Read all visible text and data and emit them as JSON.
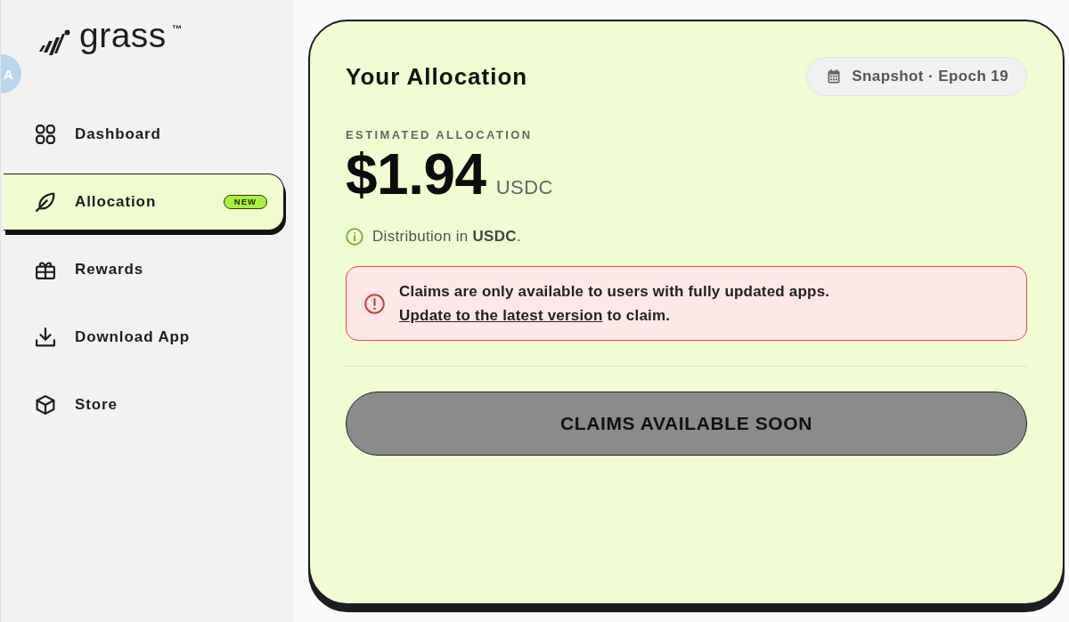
{
  "brand": {
    "name": "grass",
    "trademark": "™"
  },
  "floating_button": {
    "glyph": "A"
  },
  "sidebar": {
    "items": [
      {
        "label": "Dashboard",
        "selected": false
      },
      {
        "label": "Allocation",
        "selected": true,
        "badge": "NEW"
      },
      {
        "label": "Rewards",
        "selected": false
      },
      {
        "label": "Download App",
        "selected": false
      },
      {
        "label": "Store",
        "selected": false
      }
    ]
  },
  "allocation": {
    "title": "Your Allocation",
    "snapshot": "Snapshot · Epoch 19",
    "estimate_label": "ESTIMATED ALLOCATION",
    "amount": "$1.94",
    "currency": "USDC",
    "note": "Distribution in **USDC**.",
    "alert": {
      "message": "Claims are only available to users with fully updated apps.",
      "link": "Update to the latest version",
      "link_tail": "to claim."
    },
    "claim_button": {
      "label": "CLAIMS AVAILABLE SOON",
      "disabled": true
    }
  }
}
